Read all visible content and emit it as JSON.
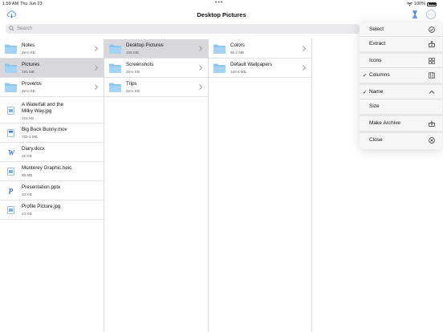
{
  "status_bar": {
    "time": "1:59 AM",
    "date": "Thu Jun 23",
    "battery": "100%"
  },
  "nav": {
    "title": "Desktop Pictures"
  },
  "search": {
    "placeholder": "Search"
  },
  "column1": [
    {
      "name": "Notes",
      "size": "Zero KB",
      "kind": "folder",
      "selected": false
    },
    {
      "name": "Pictures",
      "size": "195 MB",
      "kind": "folder",
      "selected": true
    },
    {
      "name": "Proverbs",
      "size": "Zero KB",
      "kind": "folder",
      "selected": false
    },
    {
      "name": "A Waterfall and the",
      "name2": "Milky Way.jpg",
      "size": "224 KB",
      "kind": "image"
    },
    {
      "name": "Big Buck Bunny.mov",
      "size": "725.1 MB",
      "kind": "video"
    },
    {
      "name": "Diary.docx",
      "size": "12 KB",
      "kind": "word"
    },
    {
      "name": "Monterey Graphic.heic",
      "size": "98 MB",
      "kind": "image"
    },
    {
      "name": "Presentation.pptx",
      "size": "33 KB",
      "kind": "powerpoint"
    },
    {
      "name": "Profile Picture.jpg",
      "size": "24 KB",
      "kind": "image"
    }
  ],
  "column2": [
    {
      "name": "Desktop Pictures",
      "size": "195 MB",
      "selected": true
    },
    {
      "name": "Screenshots",
      "size": "Zero KB",
      "selected": false
    },
    {
      "name": "Trips",
      "size": "Zero KB",
      "selected": false
    }
  ],
  "column3": [
    {
      "name": "Colors",
      "size": "65.2 MB"
    },
    {
      "name": "Default Wallpapers",
      "size": "129.8 MB"
    }
  ],
  "menu": {
    "select": "Select",
    "extract": "Extract",
    "icons": "Icons",
    "columns": "Columns",
    "name": "Name",
    "size": "Size",
    "make_archive": "Make Archive",
    "close": "Close",
    "checkmark": "✓"
  },
  "colors": {
    "accent": "#3478f6",
    "folder": "#8ec5f2",
    "selected_row": "#d8d8dc"
  }
}
